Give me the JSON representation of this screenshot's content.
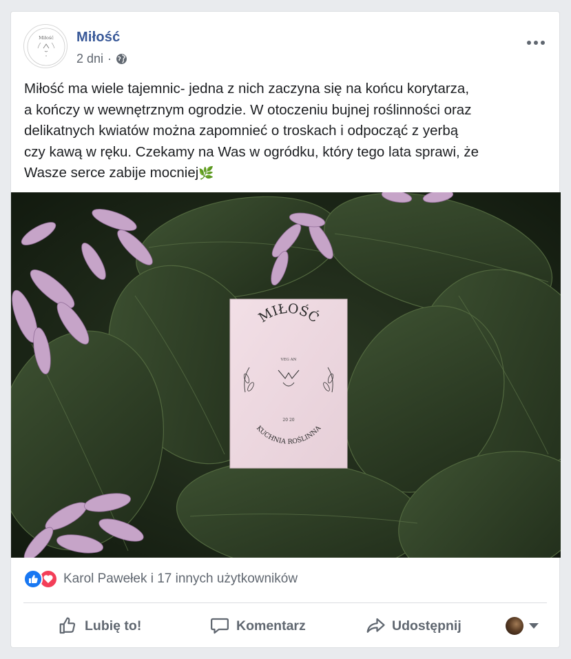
{
  "post": {
    "page_name": "Miłość",
    "time": "2 dni",
    "separator": "·",
    "text": "Miłość ma wiele tajemnic- jedna z nich zaczyna się na końcu korytarza,\na kończy w wewnętrznym ogrodzie. W otoczeniu bujnej roślinności oraz\ndelikatnych kwiatów można zapomnieć o troskach i odpocząć z yerbą\nczy kawą w ręku. Czekamy na Was w ogródku, który tego lata sprawi, że\nWasze serce zabije mocniej",
    "emoji": "🌿",
    "audience_icon": "globe-icon"
  },
  "photo": {
    "card_title": "MIŁOŚĆ",
    "card_small_top": "VEG AN",
    "card_small_bottom": "20 20",
    "card_subtitle": "KUCHNIA ROŚLINNA"
  },
  "reactions": {
    "types": [
      "like",
      "love"
    ],
    "summary": "Karol Pawełek i 17 innych użytkowników"
  },
  "actions": {
    "like": "Lubię to!",
    "comment": "Komentarz",
    "share": "Udostępnij"
  },
  "colors": {
    "link": "#385898",
    "like_blue": "#1877f2",
    "love_red": "#f33e58",
    "muted": "#606770"
  }
}
